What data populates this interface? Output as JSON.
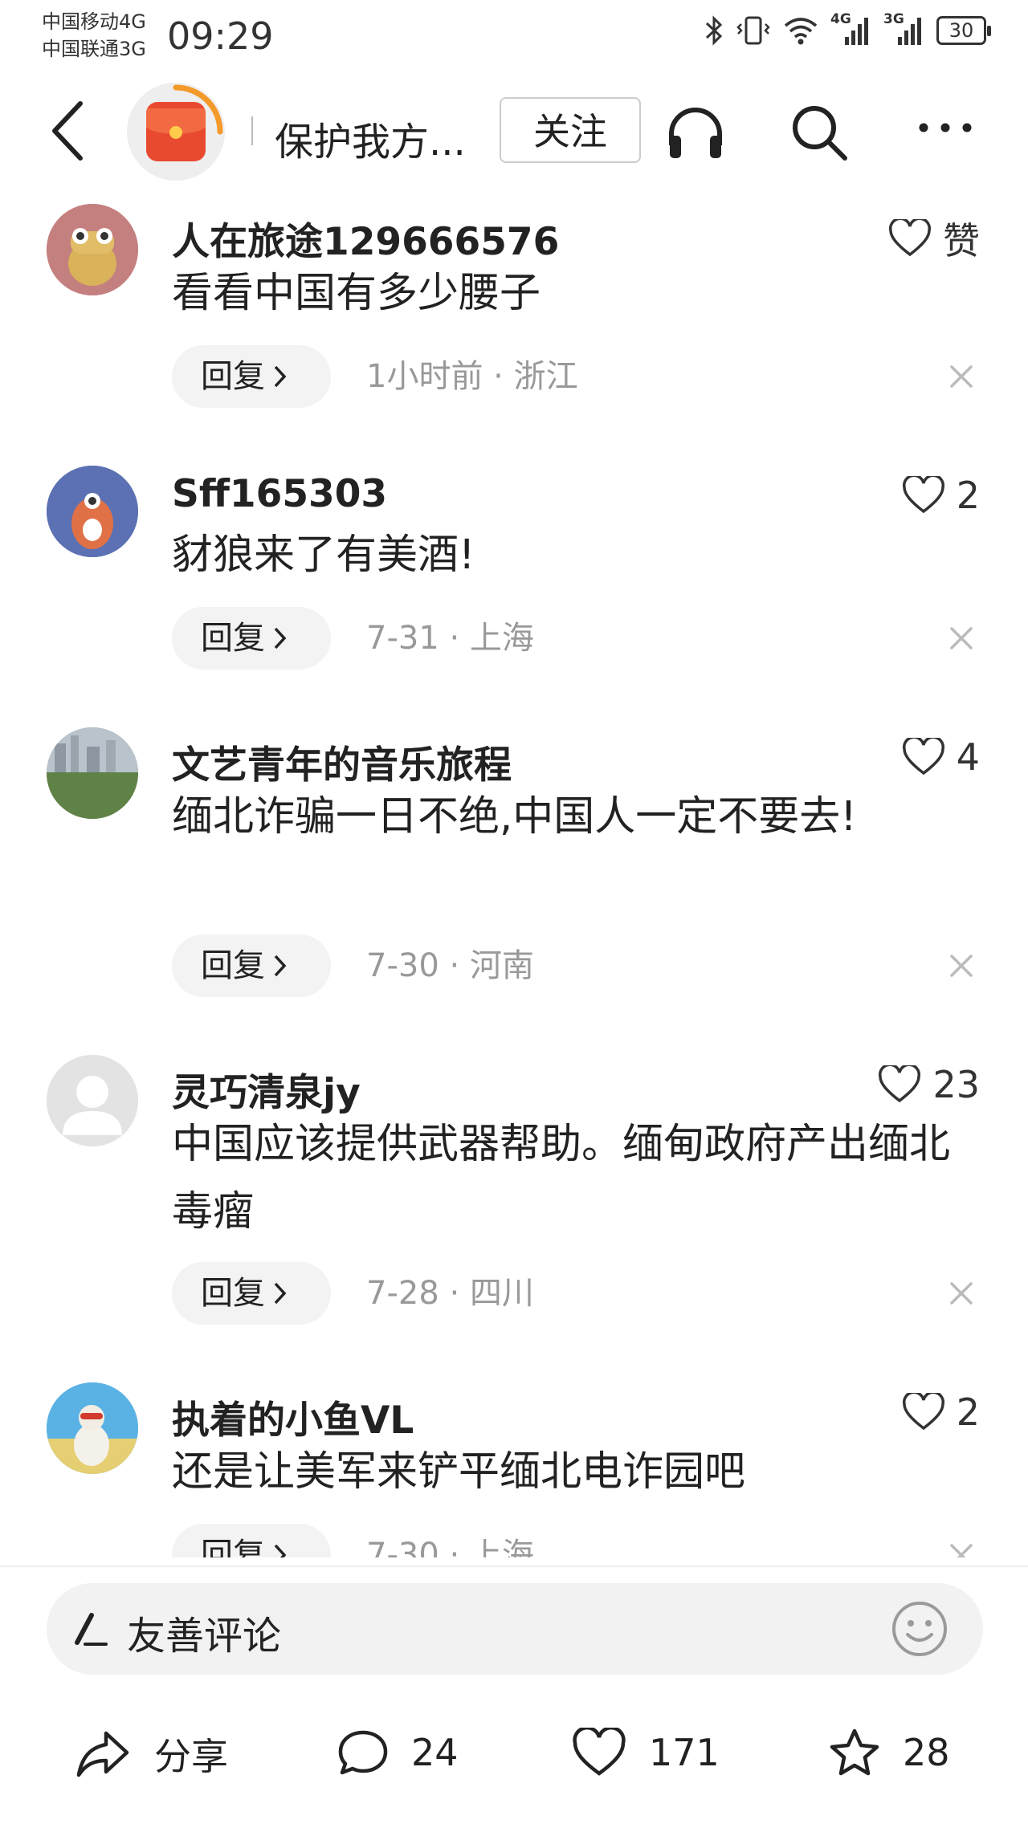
{
  "status_bar": {
    "carrier1": "中国移动4G",
    "carrier2": "中国联通3G",
    "time": "09:29",
    "net1": "4G",
    "net2": "3G",
    "battery": "30"
  },
  "header": {
    "title": "保护我方...",
    "follow_label": "关注"
  },
  "comments": [
    {
      "user": "人在旅途129666576",
      "text": "看看中国有多少腰子",
      "like": "赞",
      "reply_label": "回复",
      "time": "1小时前",
      "location": "浙江"
    },
    {
      "user": "Sff165303",
      "text": "豺狼来了有美酒!",
      "like": "2",
      "reply_label": "回复",
      "time": "7-31",
      "location": "上海"
    },
    {
      "user": "文艺青年的音乐旅程",
      "text": "缅北诈骗一日不绝,中国人一定不要去!",
      "like": "4",
      "reply_label": "回复",
      "time": "7-30",
      "location": "河南"
    },
    {
      "user": "灵巧清泉jy",
      "text": "中国应该提供武器帮助。缅甸政府产出缅北毒瘤",
      "like": "23",
      "reply_label": "回复",
      "time": "7-28",
      "location": "四川"
    },
    {
      "user": "执着的小鱼VL",
      "text": "还是让美军来铲平缅北电诈园吧",
      "like": "2",
      "reply_label": "回复",
      "time": "7-30",
      "location": "上海"
    }
  ],
  "meta_sep": " · ",
  "comment_box": {
    "placeholder": "友善评论"
  },
  "actions": {
    "share_label": "分享",
    "comment_count": "24",
    "like_count": "171",
    "favorite_count": "28"
  },
  "colors": {
    "accent_orange": "#f39a2b",
    "avatar_red": "#e84a30",
    "meta_gray": "#999999"
  }
}
